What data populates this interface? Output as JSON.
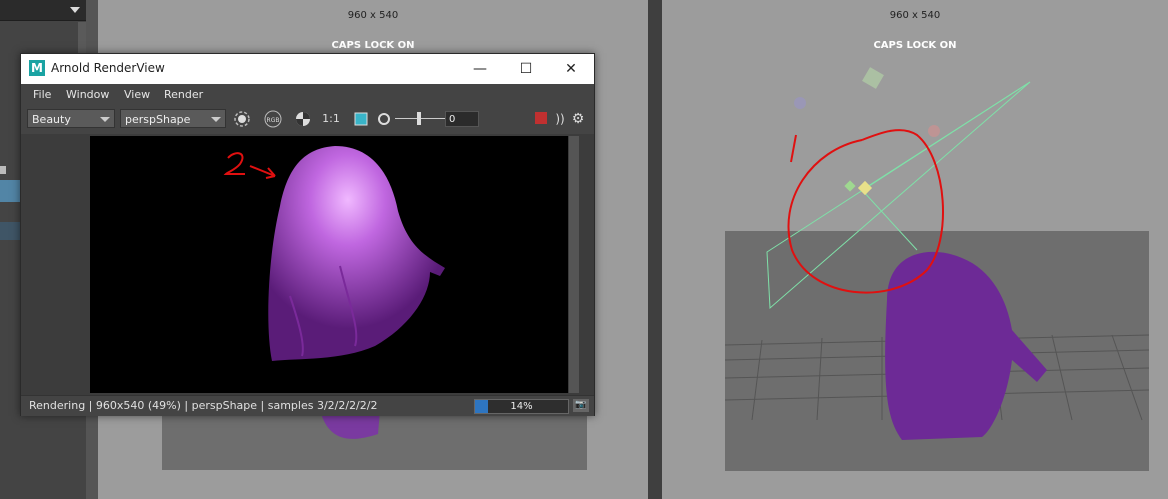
{
  "viewports": {
    "left": {
      "resolution": "960 x 540",
      "caps": "CAPS LOCK ON"
    },
    "right": {
      "resolution": "960 x 540",
      "caps": "CAPS LOCK ON"
    }
  },
  "renderview": {
    "title": "Arnold RenderView",
    "logo_letter": "M",
    "menus": [
      "File",
      "Window",
      "View",
      "Render"
    ],
    "aov_dropdown": "Beauty",
    "camera_dropdown": "perspShape",
    "ratio_label": "1:1",
    "rgb_label": "RGB",
    "exposure_value": "0",
    "status": "Rendering | 960x540 (49%) | perspShape  | samples 3/2/2/2/2/2",
    "progress": {
      "value": 0.14,
      "label": "14%"
    },
    "window_controls": {
      "minimize": "—",
      "maximize": "☐",
      "close": "✕"
    }
  },
  "annotation": {
    "handwritten_text": "2"
  },
  "colors": {
    "cloth": "#8a3fb0",
    "cloth_render": "#b45fd6",
    "annotation": "#e01010",
    "light_gizmo": "#7fe0a8"
  }
}
